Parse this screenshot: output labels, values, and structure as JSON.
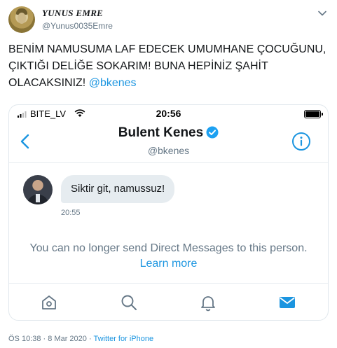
{
  "tweet": {
    "author_name": "YUNUS EMRE",
    "author_handle": "@Yunus0035Emre",
    "text": "BENİM NAMUSUMA LAF EDECEK UMUMHANE ÇOCUĞUNU, ÇIKTIĞI DELİĞE SOKARIM! BUNA HEPİNİZ ŞAHİT OLACAKSINIZ!",
    "mention": "@bkenes",
    "timestamp": "ÖS 10:38 · 8 Mar 2020",
    "separator": " · ",
    "source": "Twitter for iPhone",
    "colors": {
      "link": "#1b95e0",
      "muted": "#657786",
      "text": "#14171a"
    },
    "icons": [
      "chevron-down-icon",
      "avatar"
    ]
  },
  "screenshot": {
    "status_bar": {
      "carrier": "BITE_LV",
      "time": "20:56",
      "icons": [
        "signal-bars-icon",
        "wifi-icon",
        "battery-icon"
      ]
    },
    "header": {
      "name": "Bulent Kenes",
      "handle": "@bkenes",
      "icons": [
        "back-chevron-icon",
        "verified-badge-icon",
        "info-icon"
      ]
    },
    "message": {
      "text": "Siktir git, namussuz!",
      "time": "20:55"
    },
    "notice": {
      "text": "You can no longer send Direct Messages to this person.",
      "link": "Learn more"
    },
    "tabbar": {
      "icons": [
        "home-icon",
        "search-icon",
        "notifications-bell-icon",
        "messages-envelope-icon"
      ],
      "active": "messages-envelope-icon",
      "active_color": "#1b95e0"
    }
  }
}
